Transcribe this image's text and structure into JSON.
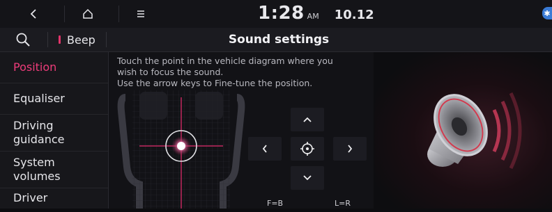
{
  "status_bar": {
    "back_icon": "chevron-left-icon",
    "home_icon": "home-icon",
    "menu_icon": "hamburger-menu-icon",
    "time": "1:28",
    "ampm": "AM",
    "date": "10.12",
    "bluetooth_icon": "bluetooth-icon"
  },
  "header": {
    "search_icon": "search-icon",
    "beep_label": "Beep",
    "title": "Sound settings"
  },
  "sidebar": {
    "items": [
      {
        "label": "Position",
        "active": true
      },
      {
        "label": "Equaliser",
        "active": false
      },
      {
        "label": "Driving\nguidance",
        "active": false
      },
      {
        "label": "System\nvolumes",
        "active": false
      },
      {
        "label": "Driver",
        "active": false
      }
    ]
  },
  "main": {
    "instruction_line1": "Touch the point in the vehicle diagram where you",
    "instruction_line2": "wish to focus the sound.",
    "instruction_line3": "Use the arrow keys to Fine-tune the position.",
    "fb_label": "F=B",
    "lr_label": "L=R"
  },
  "colors": {
    "accent": "#ee3c7a",
    "background": "#0d0d10",
    "panel": "#1c1c22"
  },
  "icons": {
    "up": "arrow-up-icon",
    "down": "arrow-down-icon",
    "left": "arrow-left-icon",
    "right": "arrow-right-icon",
    "center": "crosshair-center-icon",
    "speaker": "speaker-icon"
  }
}
